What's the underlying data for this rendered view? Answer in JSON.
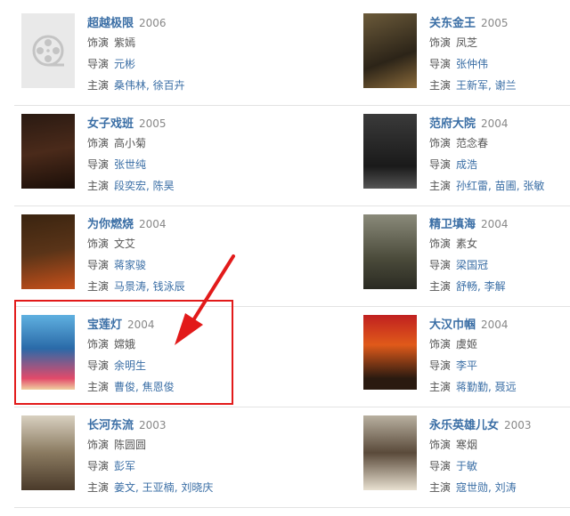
{
  "labels": {
    "role": "饰演",
    "director": "导演",
    "cast": "主演"
  },
  "colors": {
    "link": "#3a6ea5",
    "annotation": "#e21a1a"
  },
  "rows": [
    [
      {
        "title": "超越极限",
        "year": "2006",
        "role": "紫嫣",
        "director": "元彬",
        "cast": [
          "桑伟林",
          "徐百卉"
        ],
        "poster": "film-reel-placeholder"
      },
      {
        "title": "关东金王",
        "year": "2005",
        "role": "凤芝",
        "director": "张仲伟",
        "cast": [
          "王新军",
          "谢兰"
        ],
        "poster": "poster-image"
      }
    ],
    [
      {
        "title": "女子戏班",
        "year": "2005",
        "role": "高小菊",
        "director": "张世纯",
        "cast": [
          "段奕宏",
          "陈昊"
        ],
        "poster": "poster-image"
      },
      {
        "title": "范府大院",
        "year": "2004",
        "role": "范念春",
        "director": "成浩",
        "cast": [
          "孙红雷",
          "苗圃",
          "张敏"
        ],
        "poster": "poster-image"
      }
    ],
    [
      {
        "title": "为你燃烧",
        "year": "2004",
        "role": "文艾",
        "director": "蒋家骏",
        "cast": [
          "马景涛",
          "钱泳辰"
        ],
        "poster": "poster-image"
      },
      {
        "title": "精卫填海",
        "year": "2004",
        "role": "素女",
        "director": "梁国冠",
        "cast": [
          "舒畅",
          "李解"
        ],
        "poster": "poster-image"
      }
    ],
    [
      {
        "title": "宝莲灯",
        "year": "2004",
        "role": "嫦娥",
        "director": "余明生",
        "cast": [
          "曹俊",
          "焦恩俊"
        ],
        "poster": "poster-image"
      },
      {
        "title": "大汉巾帼",
        "year": "2004",
        "role": "虞姬",
        "director": "李平",
        "cast": [
          "蒋勤勤",
          "聂远"
        ],
        "poster": "poster-image"
      }
    ],
    [
      {
        "title": "长河东流",
        "year": "2003",
        "role": "陈圆圆",
        "director": "彭军",
        "cast": [
          "姜文",
          "王亚楠",
          "刘晓庆"
        ],
        "poster": "poster-image"
      },
      {
        "title": "永乐英雄儿女",
        "year": "2003",
        "role": "寒烟",
        "director": "于敏",
        "cast": [
          "寇世勋",
          "刘涛"
        ],
        "poster": "poster-image"
      }
    ]
  ]
}
